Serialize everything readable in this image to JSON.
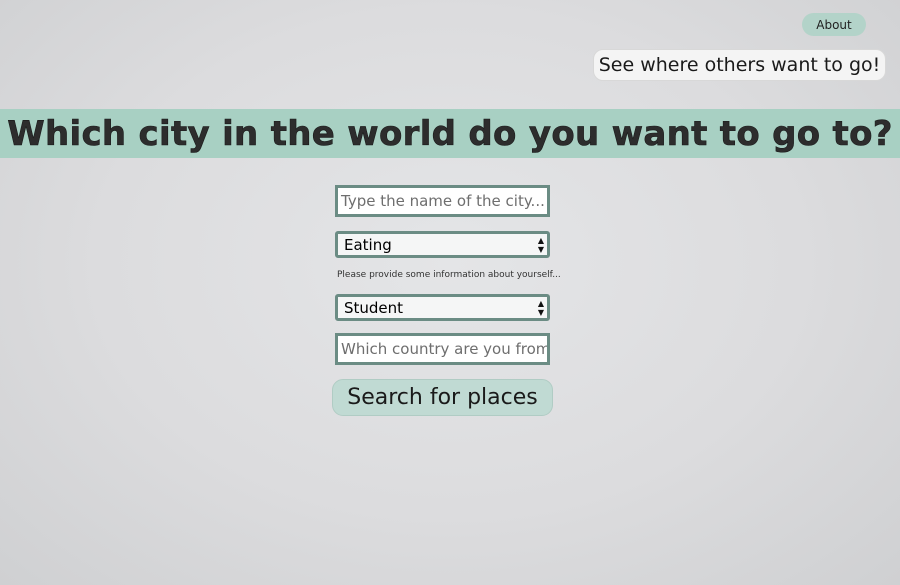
{
  "header": {
    "about_label": "About",
    "others_label": "See where others want to go!"
  },
  "banner": {
    "title": "Which city in the world do you want to go to?"
  },
  "form": {
    "city_placeholder": "Type the name of the city...",
    "activity_selected": "Eating",
    "helper_text": "Please provide some information about yourself...",
    "occupation_selected": "Student",
    "country_placeholder": "Which country are you from?",
    "search_label": "Search for places"
  },
  "colors": {
    "accent": "#a8d0c3",
    "field_border": "#6b8c84",
    "button": "#c0dad3"
  }
}
